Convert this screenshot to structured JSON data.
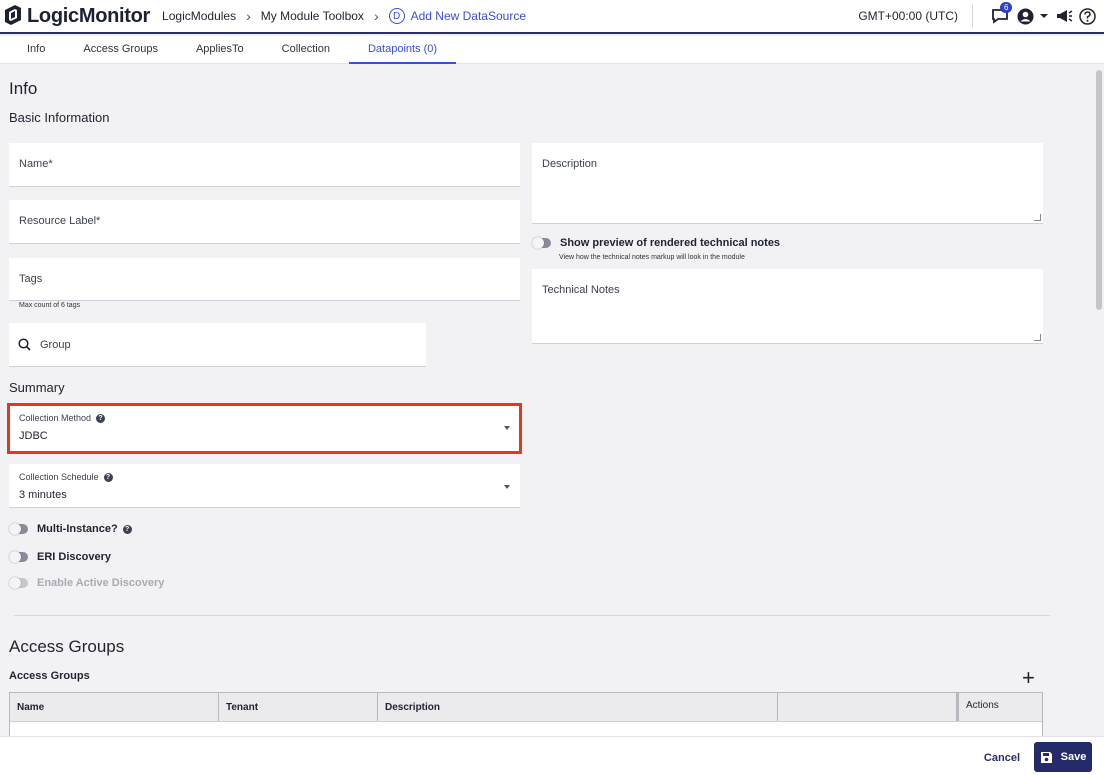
{
  "brand": {
    "name": "LogicMonitor"
  },
  "breadcrumb": {
    "items": [
      "LogicModules",
      "My Module Toolbox"
    ],
    "current_badge": "D",
    "current": "Add New DataSource"
  },
  "topbar": {
    "timezone": "GMT+00:00 (UTC)",
    "notification_count": "6"
  },
  "tabs": [
    {
      "label": "Info"
    },
    {
      "label": "Access Groups"
    },
    {
      "label": "AppliesTo"
    },
    {
      "label": "Collection"
    },
    {
      "label": "Datapoints (0)",
      "active": true
    }
  ],
  "info": {
    "title": "Info",
    "basic_title": "Basic Information",
    "name_label": "Name*",
    "resource_label": "Resource Label*",
    "tags_label": "Tags",
    "tags_hint": "Max count of 6 tags",
    "group_label": "Group",
    "description_label": "Description",
    "preview_toggle_label": "Show preview of rendered technical notes",
    "preview_toggle_sub": "View how the technical notes markup will look in the module",
    "technical_notes_label": "Technical Notes"
  },
  "summary": {
    "title": "Summary",
    "collection_method_label": "Collection Method",
    "collection_method_value": "JDBC",
    "collection_schedule_label": "Collection Schedule",
    "collection_schedule_value": "3 minutes",
    "multi_instance_label": "Multi-Instance?",
    "eri_label": "ERI Discovery",
    "active_discovery_label": "Enable Active Discovery"
  },
  "access_groups": {
    "title": "Access Groups",
    "subtitle": "Access Groups",
    "columns": [
      "Name",
      "Tenant",
      "Description",
      "",
      "Actions"
    ]
  },
  "footer": {
    "cancel_label": "Cancel",
    "save_label": "Save"
  },
  "colors": {
    "accent": "#3a4fd6",
    "navy": "#242a6a",
    "highlight": "#e03a1e"
  }
}
